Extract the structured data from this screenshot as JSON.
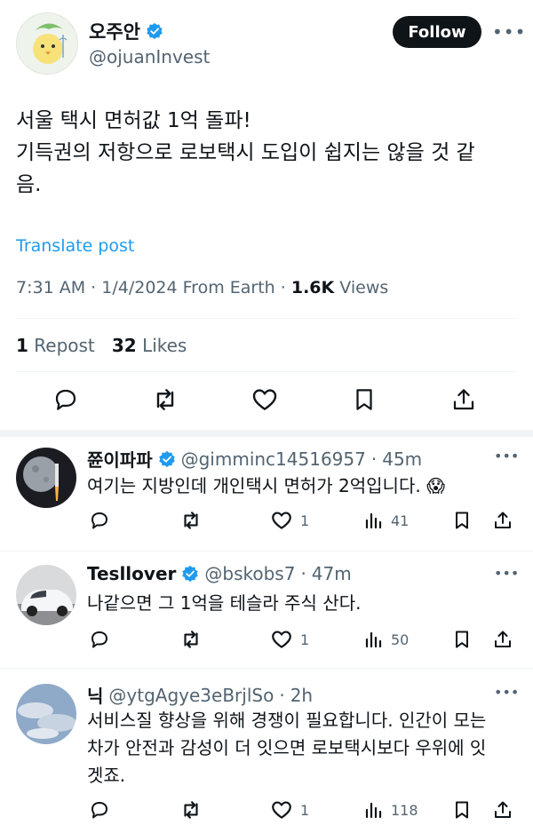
{
  "author": {
    "name": "오주안",
    "handle": "@ojuanInvest",
    "follow_label": "Follow",
    "more_label": "•••"
  },
  "post": {
    "line1": "서울 택시 면허값 1억 돌파!",
    "line2": "기득권의 저항으로 로보택시 도입이 쉽지는 않을 것 같\n음.",
    "translate_label": "Translate post",
    "time": "7:31 AM",
    "date": "1/4/2024",
    "source": "From Earth",
    "views_count": "1.6K",
    "views_label": "Views",
    "reposts_count": "1",
    "reposts_label": "Repost",
    "likes_count": "32",
    "likes_label": "Likes"
  },
  "replies": [
    {
      "name": "쮼이파파",
      "handle": "@gimminc14516957",
      "time": "45m",
      "text": "여기는 지방인데 개인택시 면허가 2억입니다.",
      "emoji": "😱",
      "likes": "1",
      "views": "41",
      "more": "•••"
    },
    {
      "name": "Tesllover",
      "handle": "@bskobs7",
      "time": "47m",
      "text": "나같으면 그 1억을 테슬라 주식 산다.",
      "likes": "1",
      "views": "50",
      "more": "•••"
    },
    {
      "name": "닉",
      "handle": "@ytgAgye3eBrjlSo",
      "time": "2h",
      "text": "서비스질 향상을 위해 경쟁이 필요합니다. 인간이 모는\n차가 안전과 감성이 더 잇으면 로보택시보다 우위에 잇\n겟죠.",
      "likes": "1",
      "views": "118",
      "more": "•••"
    }
  ],
  "separators": {
    "dot": "·"
  },
  "colors": {
    "accent": "#1d9bf0",
    "text": "#0f1419",
    "muted": "#536471",
    "verified": "#1d9bf0"
  }
}
